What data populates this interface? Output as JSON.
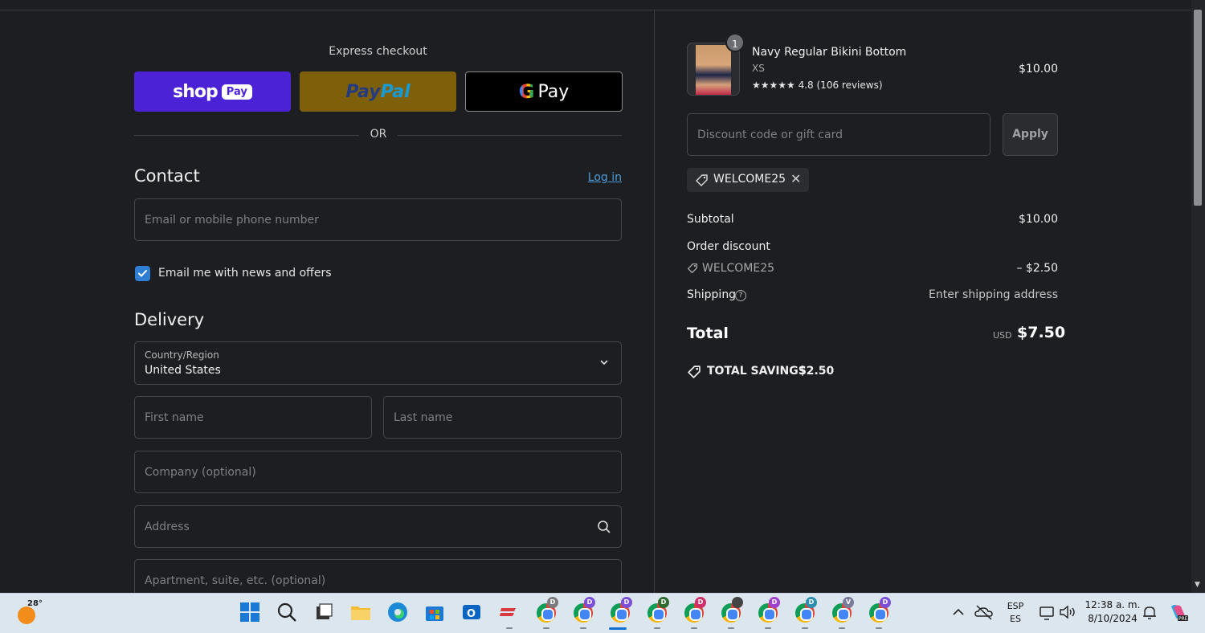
{
  "express": {
    "title": "Express checkout",
    "shop_pay_word": "shop",
    "shop_pay_pill": "Pay",
    "paypal_1": "Pay",
    "paypal_2": "Pal",
    "gpay_g": "G",
    "gpay_word": "Pay",
    "or": "OR"
  },
  "contact": {
    "title": "Contact",
    "login": "Log in",
    "email_placeholder": "Email or mobile phone number",
    "news_label": "Email me with news and offers",
    "news_checked": true
  },
  "delivery": {
    "title": "Delivery",
    "country_label": "Country/Region",
    "country_value": "United States",
    "first_name": "First name",
    "last_name": "Last name",
    "company": "Company (optional)",
    "address": "Address",
    "apartment": "Apartment, suite, etc. (optional)"
  },
  "summary": {
    "item": {
      "qty": "1",
      "name": "Navy Regular Bikini Bottom",
      "variant": "XS",
      "rating": "★★★★★ 4.8 (106 reviews)",
      "price": "$10.00"
    },
    "discount_placeholder": "Discount code or gift card",
    "apply": "Apply",
    "applied_code": "WELCOME25",
    "subtotal_label": "Subtotal",
    "subtotal_value": "$10.00",
    "order_discount_label": "Order discount",
    "order_discount_code": "WELCOME25",
    "order_discount_value": "– $2.50",
    "shipping_label": "Shipping",
    "shipping_value": "Enter shipping address",
    "total_label": "Total",
    "total_currency": "USD",
    "total_value": "$7.50",
    "savings_label": "TOTAL SAVINGS",
    "savings_value": "$2.50"
  },
  "taskbar": {
    "temperature": "28°",
    "lang_1": "ESP",
    "lang_2": "ES",
    "time": "12:38 a. m.",
    "date": "8/10/2024",
    "profiles": [
      {
        "letter": "D",
        "color": "#7a7a7a"
      },
      {
        "letter": "D",
        "color": "#7b4fd6"
      },
      {
        "letter": "D",
        "color": "#7b4fd6"
      },
      {
        "letter": "D",
        "color": "#2e6b2e"
      },
      {
        "letter": "D",
        "color": "#d0306a"
      },
      {
        "letter": "",
        "color": "#444"
      },
      {
        "letter": "D",
        "color": "#a040d0"
      },
      {
        "letter": "D",
        "color": "#2a8fb0"
      },
      {
        "letter": "V",
        "color": "#7a7a9a"
      },
      {
        "letter": "D",
        "color": "#7b4fd6"
      }
    ]
  }
}
